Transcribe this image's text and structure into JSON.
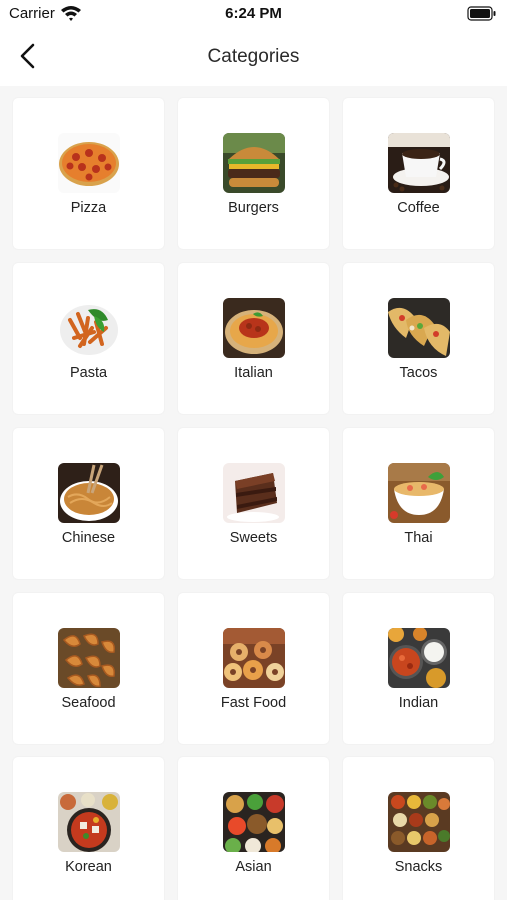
{
  "status": {
    "carrier": "Carrier",
    "time": "6:24 PM"
  },
  "nav": {
    "title": "Categories"
  },
  "categories": [
    {
      "label": "Pizza",
      "icon": "pizza-image"
    },
    {
      "label": "Burgers",
      "icon": "burger-image"
    },
    {
      "label": "Coffee",
      "icon": "coffee-image"
    },
    {
      "label": "Pasta",
      "icon": "pasta-image"
    },
    {
      "label": "Italian",
      "icon": "spaghetti-image"
    },
    {
      "label": "Tacos",
      "icon": "tacos-image"
    },
    {
      "label": "Chinese",
      "icon": "noodles-image"
    },
    {
      "label": "Sweets",
      "icon": "cake-image"
    },
    {
      "label": "Thai",
      "icon": "soup-bowl-image"
    },
    {
      "label": "Seafood",
      "icon": "shrimp-image"
    },
    {
      "label": "Fast Food",
      "icon": "donuts-image"
    },
    {
      "label": "Indian",
      "icon": "curry-dishes-image"
    },
    {
      "label": "Korean",
      "icon": "korean-stew-image"
    },
    {
      "label": "Asian",
      "icon": "asian-platter-image"
    },
    {
      "label": "Snacks",
      "icon": "spice-bowls-image"
    }
  ]
}
